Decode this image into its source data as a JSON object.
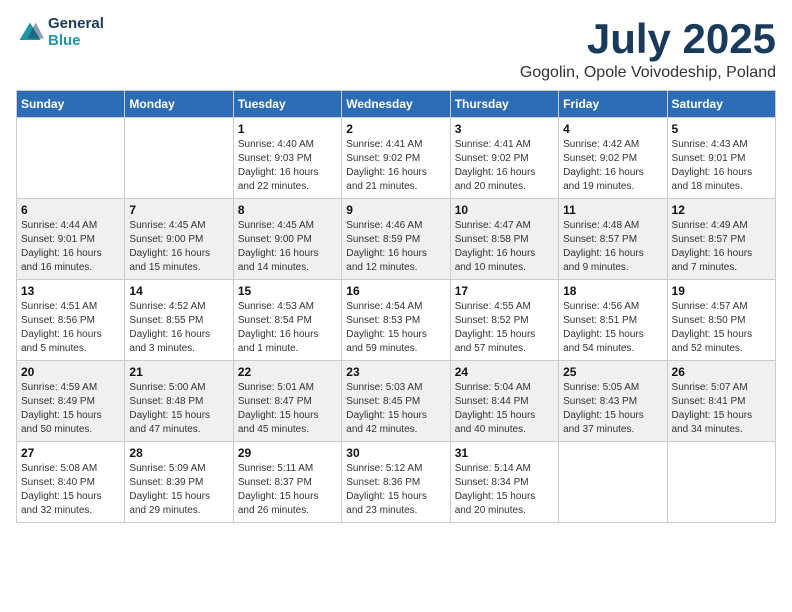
{
  "logo": {
    "text_general": "General",
    "text_blue": "Blue"
  },
  "title": "July 2025",
  "location": "Gogolin, Opole Voivodeship, Poland",
  "days_of_week": [
    "Sunday",
    "Monday",
    "Tuesday",
    "Wednesday",
    "Thursday",
    "Friday",
    "Saturday"
  ],
  "weeks": [
    [
      {
        "day": "",
        "info": ""
      },
      {
        "day": "",
        "info": ""
      },
      {
        "day": "1",
        "info": "Sunrise: 4:40 AM\nSunset: 9:03 PM\nDaylight: 16 hours and 22 minutes."
      },
      {
        "day": "2",
        "info": "Sunrise: 4:41 AM\nSunset: 9:02 PM\nDaylight: 16 hours and 21 minutes."
      },
      {
        "day": "3",
        "info": "Sunrise: 4:41 AM\nSunset: 9:02 PM\nDaylight: 16 hours and 20 minutes."
      },
      {
        "day": "4",
        "info": "Sunrise: 4:42 AM\nSunset: 9:02 PM\nDaylight: 16 hours and 19 minutes."
      },
      {
        "day": "5",
        "info": "Sunrise: 4:43 AM\nSunset: 9:01 PM\nDaylight: 16 hours and 18 minutes."
      }
    ],
    [
      {
        "day": "6",
        "info": "Sunrise: 4:44 AM\nSunset: 9:01 PM\nDaylight: 16 hours and 16 minutes."
      },
      {
        "day": "7",
        "info": "Sunrise: 4:45 AM\nSunset: 9:00 PM\nDaylight: 16 hours and 15 minutes."
      },
      {
        "day": "8",
        "info": "Sunrise: 4:45 AM\nSunset: 9:00 PM\nDaylight: 16 hours and 14 minutes."
      },
      {
        "day": "9",
        "info": "Sunrise: 4:46 AM\nSunset: 8:59 PM\nDaylight: 16 hours and 12 minutes."
      },
      {
        "day": "10",
        "info": "Sunrise: 4:47 AM\nSunset: 8:58 PM\nDaylight: 16 hours and 10 minutes."
      },
      {
        "day": "11",
        "info": "Sunrise: 4:48 AM\nSunset: 8:57 PM\nDaylight: 16 hours and 9 minutes."
      },
      {
        "day": "12",
        "info": "Sunrise: 4:49 AM\nSunset: 8:57 PM\nDaylight: 16 hours and 7 minutes."
      }
    ],
    [
      {
        "day": "13",
        "info": "Sunrise: 4:51 AM\nSunset: 8:56 PM\nDaylight: 16 hours and 5 minutes."
      },
      {
        "day": "14",
        "info": "Sunrise: 4:52 AM\nSunset: 8:55 PM\nDaylight: 16 hours and 3 minutes."
      },
      {
        "day": "15",
        "info": "Sunrise: 4:53 AM\nSunset: 8:54 PM\nDaylight: 16 hours and 1 minute."
      },
      {
        "day": "16",
        "info": "Sunrise: 4:54 AM\nSunset: 8:53 PM\nDaylight: 15 hours and 59 minutes."
      },
      {
        "day": "17",
        "info": "Sunrise: 4:55 AM\nSunset: 8:52 PM\nDaylight: 15 hours and 57 minutes."
      },
      {
        "day": "18",
        "info": "Sunrise: 4:56 AM\nSunset: 8:51 PM\nDaylight: 15 hours and 54 minutes."
      },
      {
        "day": "19",
        "info": "Sunrise: 4:57 AM\nSunset: 8:50 PM\nDaylight: 15 hours and 52 minutes."
      }
    ],
    [
      {
        "day": "20",
        "info": "Sunrise: 4:59 AM\nSunset: 8:49 PM\nDaylight: 15 hours and 50 minutes."
      },
      {
        "day": "21",
        "info": "Sunrise: 5:00 AM\nSunset: 8:48 PM\nDaylight: 15 hours and 47 minutes."
      },
      {
        "day": "22",
        "info": "Sunrise: 5:01 AM\nSunset: 8:47 PM\nDaylight: 15 hours and 45 minutes."
      },
      {
        "day": "23",
        "info": "Sunrise: 5:03 AM\nSunset: 8:45 PM\nDaylight: 15 hours and 42 minutes."
      },
      {
        "day": "24",
        "info": "Sunrise: 5:04 AM\nSunset: 8:44 PM\nDaylight: 15 hours and 40 minutes."
      },
      {
        "day": "25",
        "info": "Sunrise: 5:05 AM\nSunset: 8:43 PM\nDaylight: 15 hours and 37 minutes."
      },
      {
        "day": "26",
        "info": "Sunrise: 5:07 AM\nSunset: 8:41 PM\nDaylight: 15 hours and 34 minutes."
      }
    ],
    [
      {
        "day": "27",
        "info": "Sunrise: 5:08 AM\nSunset: 8:40 PM\nDaylight: 15 hours and 32 minutes."
      },
      {
        "day": "28",
        "info": "Sunrise: 5:09 AM\nSunset: 8:39 PM\nDaylight: 15 hours and 29 minutes."
      },
      {
        "day": "29",
        "info": "Sunrise: 5:11 AM\nSunset: 8:37 PM\nDaylight: 15 hours and 26 minutes."
      },
      {
        "day": "30",
        "info": "Sunrise: 5:12 AM\nSunset: 8:36 PM\nDaylight: 15 hours and 23 minutes."
      },
      {
        "day": "31",
        "info": "Sunrise: 5:14 AM\nSunset: 8:34 PM\nDaylight: 15 hours and 20 minutes."
      },
      {
        "day": "",
        "info": ""
      },
      {
        "day": "",
        "info": ""
      }
    ]
  ]
}
